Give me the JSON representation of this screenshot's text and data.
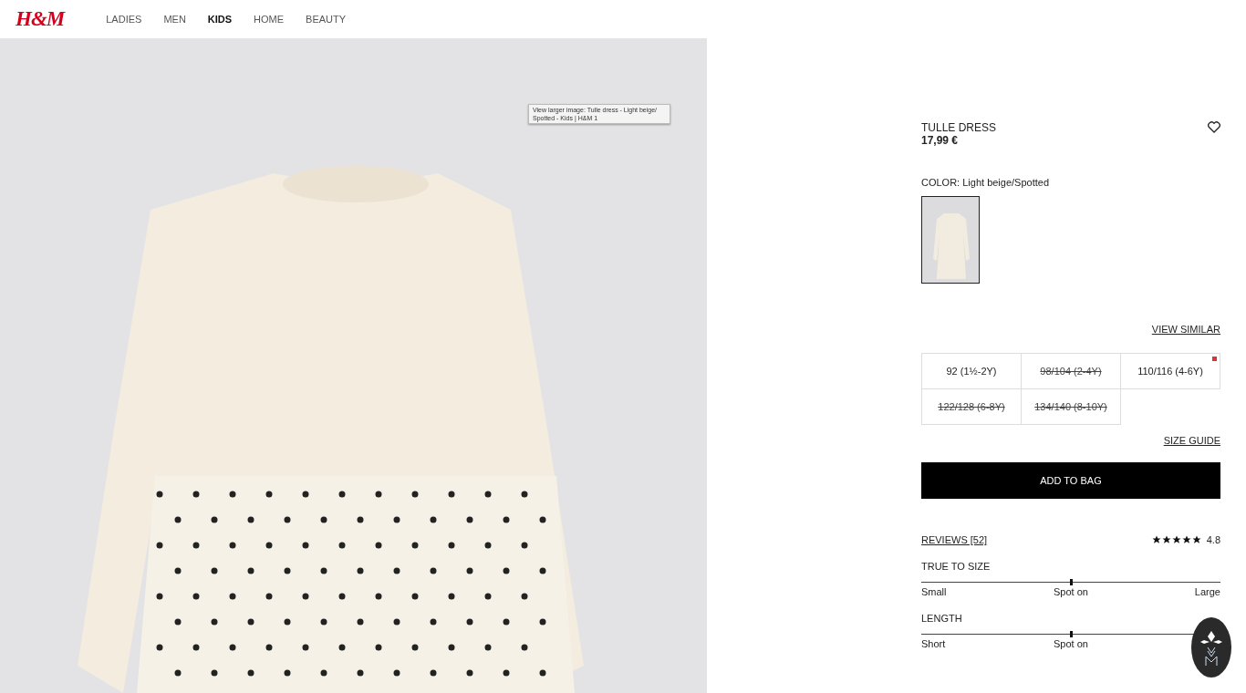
{
  "header": {
    "logo": "H&M",
    "nav": [
      {
        "label": "LADIES",
        "selected": false
      },
      {
        "label": "MEN",
        "selected": false
      },
      {
        "label": "KIDS",
        "selected": true
      },
      {
        "label": "HOME",
        "selected": false
      },
      {
        "label": "BEAUTY",
        "selected": false
      }
    ]
  },
  "gallery": {
    "tooltip": "View larger image: Tulle dress - Light beige/ Spotted - Kids | H&M 1"
  },
  "product": {
    "name": "TULLE DRESS",
    "price": "17,99 €",
    "favorite": false,
    "color_label": "COLOR: Light beige/Spotted",
    "swatches": [
      {
        "selected": true
      }
    ],
    "view_similar": "VIEW SIMILAR",
    "sizes": [
      {
        "label": "92 (1½-2Y)",
        "sold_out": false,
        "low_stock": false
      },
      {
        "label": "98/104 (2-4Y)",
        "sold_out": true,
        "low_stock": false
      },
      {
        "label": "110/116 (4-6Y)",
        "sold_out": false,
        "low_stock": true
      },
      {
        "label": "122/128 (6-8Y)",
        "sold_out": true,
        "low_stock": false
      },
      {
        "label": "134/140 (8-10Y)",
        "sold_out": true,
        "low_stock": false
      }
    ],
    "size_guide": "SIZE GUIDE",
    "add_to_bag": "ADD TO BAG",
    "reviews": "REVIEWS [52]",
    "stars": 5,
    "rating": "4.8",
    "fit": [
      {
        "title": "TRUE TO SIZE",
        "level": 0.5,
        "labels": [
          "Small",
          "Spot on",
          "Large"
        ]
      },
      {
        "title": "LENGTH",
        "level": 0.5,
        "labels": [
          "Short",
          "Spot on"
        ]
      }
    ]
  }
}
